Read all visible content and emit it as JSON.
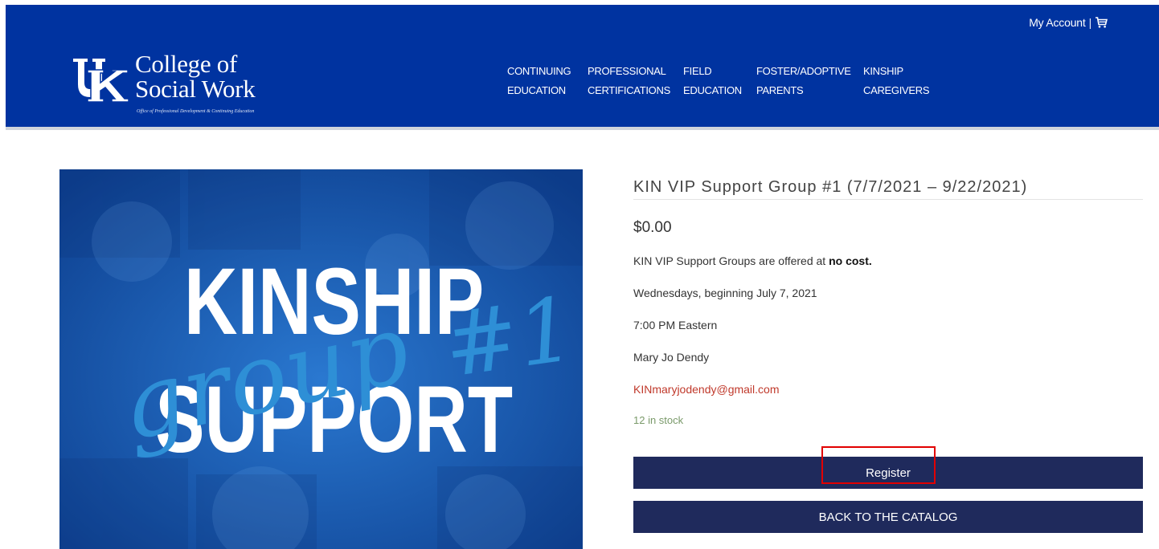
{
  "header": {
    "account_label": "My Account",
    "separator": "|",
    "cart_icon": "cart-icon",
    "logo": {
      "title_line1": "College of",
      "title_line2": "Social Work",
      "subtitle": "Office of Professional Development & Continuing Education",
      "mark": "UK"
    },
    "nav": [
      {
        "line1": "CONTINUING",
        "line2": "EDUCATION"
      },
      {
        "line1": "PROFESSIONAL",
        "line2": "CERTIFICATIONS"
      },
      {
        "line1": "FIELD",
        "line2": "EDUCATION"
      },
      {
        "line1": "FOSTER/ADOPTIVE",
        "line2": "PARENTS"
      },
      {
        "line1": "KINSHIP",
        "line2": "CAREGIVERS"
      }
    ],
    "bg_color": "#0033a0"
  },
  "hero": {
    "word1": "KINSHIP",
    "script_word": "group",
    "number": "#1",
    "word2": "SUPPORT"
  },
  "product": {
    "title": "KIN VIP Support Group #1 (7/7/2021 – 9/22/2021)",
    "price": "$0.00",
    "cost_prefix": "KIN VIP Support Groups are offered at ",
    "cost_bold": "no cost.",
    "schedule": "Wednesdays, beginning July 7, 2021",
    "time": "7:00 PM Eastern",
    "facilitator": "Mary Jo Dendy",
    "email": "KINmaryjodendy@gmail.com",
    "stock": "12 in stock",
    "register_label": "Register",
    "back_label": "BACK TO THE CATALOG",
    "button_color": "#1f2a5c"
  }
}
